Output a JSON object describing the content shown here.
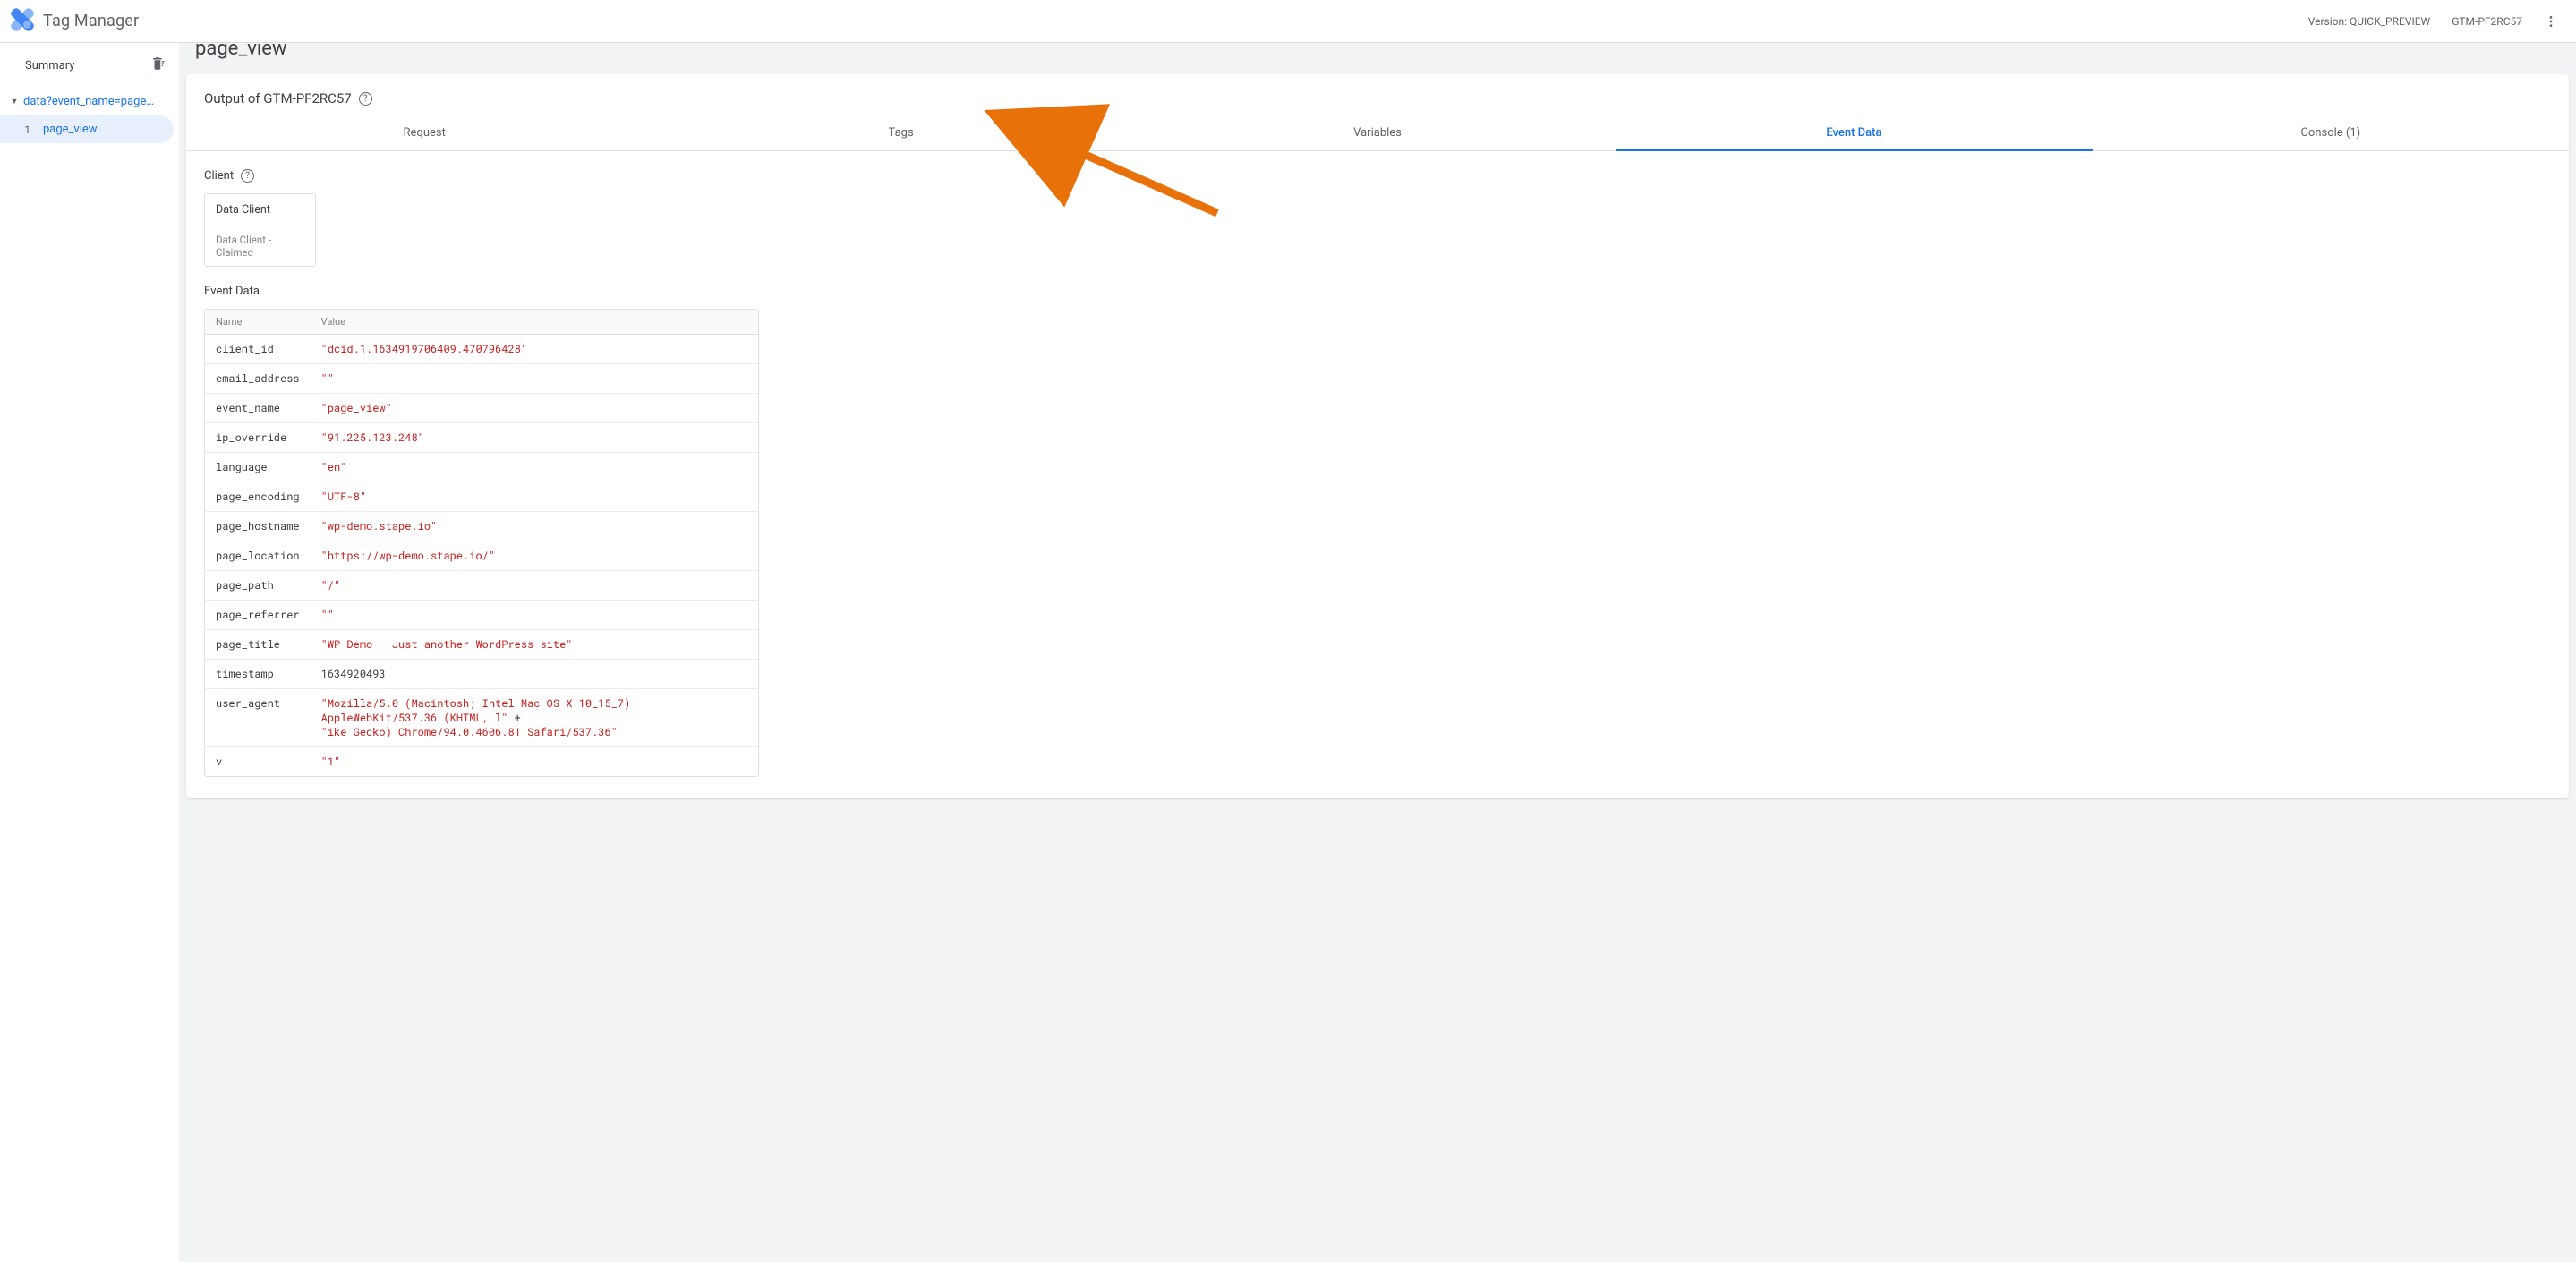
{
  "header": {
    "app_title": "Tag Manager",
    "version_label": "Version: QUICK_PREVIEW",
    "container_id": "GTM-PF2RC57"
  },
  "sidebar": {
    "summary_label": "Summary",
    "tree_item_label": "data?event_name=page_vi…",
    "sub_items": [
      {
        "index": "1",
        "label": "page_view",
        "active": true
      }
    ]
  },
  "page": {
    "heading": "page_view",
    "output_title": "Output of GTM-PF2RC57",
    "tabs": [
      {
        "id": "request",
        "label": "Request",
        "active": false
      },
      {
        "id": "tags",
        "label": "Tags",
        "active": false
      },
      {
        "id": "variables",
        "label": "Variables",
        "active": false
      },
      {
        "id": "eventdata",
        "label": "Event Data",
        "active": true
      },
      {
        "id": "console",
        "label": "Console (1)",
        "active": false
      }
    ]
  },
  "client": {
    "section_label": "Client",
    "name": "Data Client",
    "status": "Data Client - Claimed"
  },
  "event_data": {
    "section_label": "Event Data",
    "columns": {
      "name": "Name",
      "value": "Value"
    },
    "rows": [
      {
        "name": "client_id",
        "type": "string",
        "value": "dcid.1.1634919706409.470796428"
      },
      {
        "name": "email_address",
        "type": "string",
        "value": ""
      },
      {
        "name": "event_name",
        "type": "string",
        "value": "page_view"
      },
      {
        "name": "ip_override",
        "type": "string",
        "value": "91.225.123.248"
      },
      {
        "name": "language",
        "type": "string",
        "value": "en"
      },
      {
        "name": "page_encoding",
        "type": "string",
        "value": "UTF-8"
      },
      {
        "name": "page_hostname",
        "type": "string",
        "value": "wp-demo.stape.io"
      },
      {
        "name": "page_location",
        "type": "string",
        "value": "https://wp-demo.stape.io/"
      },
      {
        "name": "page_path",
        "type": "string",
        "value": "/"
      },
      {
        "name": "page_referrer",
        "type": "string",
        "value": ""
      },
      {
        "name": "page_title",
        "type": "string",
        "value": "WP Demo – Just another WordPress site"
      },
      {
        "name": "timestamp",
        "type": "number",
        "value": "1634920493"
      },
      {
        "name": "user_agent",
        "type": "string_concat",
        "parts": [
          "Mozilla/5.0 (Macintosh; Intel Mac OS X 10_15_7) AppleWebKit/537.36 (KHTML, l",
          "ike Gecko) Chrome/94.0.4606.81 Safari/537.36"
        ]
      },
      {
        "name": "v",
        "type": "string",
        "value": "1"
      }
    ]
  }
}
